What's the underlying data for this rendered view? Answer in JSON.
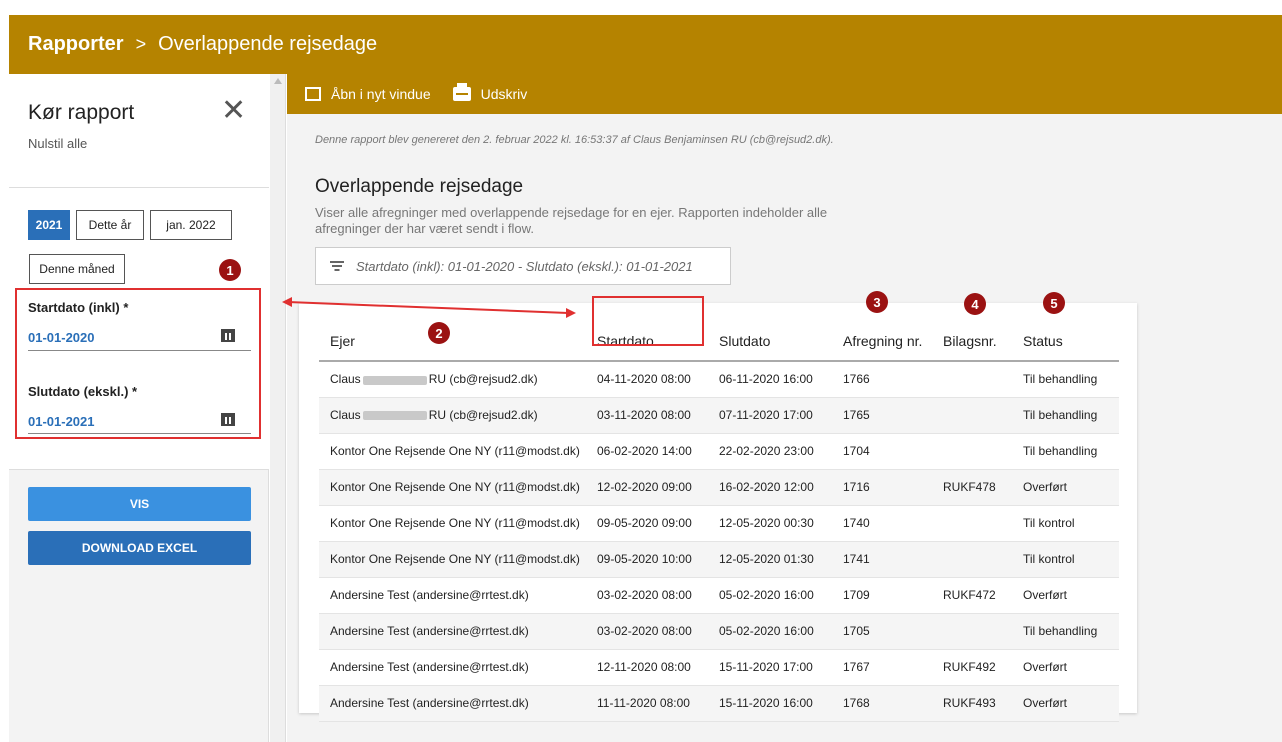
{
  "header": {
    "breadcrumb_root": "Rapporter",
    "breadcrumb_sep": ">",
    "breadcrumb_page": "Overlappende rejsedage"
  },
  "sidebar": {
    "title": "Kør rapport",
    "reset": "Nulstil alle",
    "chips": [
      "2021",
      "Dette år",
      "jan. 2022",
      "Denne måned"
    ],
    "start_label": "Startdato (inkl) *",
    "start_value": "01-01-2020",
    "end_label": "Slutdato (ekskl.) *",
    "end_value": "01-01-2021",
    "btn_vis": "VIS",
    "btn_excel": "DOWNLOAD EXCEL"
  },
  "toolbar": {
    "open_new": "Åbn i nyt vindue",
    "print": "Udskriv"
  },
  "report": {
    "generated_note": "Denne rapport blev genereret den 2. februar 2022 kl. 16:53:37 af Claus Benjaminsen RU (cb@rejsud2.dk).",
    "title": "Overlappende rejsedage",
    "description": "Viser alle afregninger med overlappende rejsedage for en ejer. Rapporten indeholder alle afregninger der har været sendt i flow.",
    "filter": "Startdato (inkl): 01-01-2020 - Slutdato (ekskl.): 01-01-2021"
  },
  "table": {
    "columns": [
      "Ejer",
      "Startdato",
      "Slutdato",
      "Afregning nr.",
      "Bilagsnr.",
      "Status"
    ],
    "rows": [
      {
        "owner_pre": "Claus",
        "owner_post": "RU (cb@rejsud2.dk)",
        "start": "04-11-2020 08:00",
        "end": "06-11-2020 16:00",
        "nr": "1766",
        "bilag": "",
        "status": "Til behandling"
      },
      {
        "owner_pre": "Claus",
        "owner_post": "RU (cb@rejsud2.dk)",
        "start": "03-11-2020 08:00",
        "end": "07-11-2020 17:00",
        "nr": "1765",
        "bilag": "",
        "status": "Til behandling"
      },
      {
        "owner_pre": "Kontor One Rejsende One NY (r11@modst.dk)",
        "owner_post": "",
        "start": "06-02-2020 14:00",
        "end": "22-02-2020 23:00",
        "nr": "1704",
        "bilag": "",
        "status": "Til behandling"
      },
      {
        "owner_pre": "Kontor One Rejsende One NY (r11@modst.dk)",
        "owner_post": "",
        "start": "12-02-2020 09:00",
        "end": "16-02-2020 12:00",
        "nr": "1716",
        "bilag": "RUKF478",
        "status": "Overført"
      },
      {
        "owner_pre": "Kontor One Rejsende One NY (r11@modst.dk)",
        "owner_post": "",
        "start": "09-05-2020 09:00",
        "end": "12-05-2020 00:30",
        "nr": "1740",
        "bilag": "",
        "status": "Til kontrol"
      },
      {
        "owner_pre": "Kontor One Rejsende One NY (r11@modst.dk)",
        "owner_post": "",
        "start": "09-05-2020 10:00",
        "end": "12-05-2020 01:30",
        "nr": "1741",
        "bilag": "",
        "status": "Til kontrol"
      },
      {
        "owner_pre": "Andersine Test (andersine@rrtest.dk)",
        "owner_post": "",
        "start": "03-02-2020 08:00",
        "end": "05-02-2020 16:00",
        "nr": "1709",
        "bilag": "RUKF472",
        "status": "Overført"
      },
      {
        "owner_pre": "Andersine Test (andersine@rrtest.dk)",
        "owner_post": "",
        "start": "03-02-2020 08:00",
        "end": "05-02-2020 16:00",
        "nr": "1705",
        "bilag": "",
        "status": "Til behandling"
      },
      {
        "owner_pre": "Andersine Test (andersine@rrtest.dk)",
        "owner_post": "",
        "start": "12-11-2020 08:00",
        "end": "15-11-2020 17:00",
        "nr": "1767",
        "bilag": "RUKF492",
        "status": "Overført"
      },
      {
        "owner_pre": "Andersine Test (andersine@rrtest.dk)",
        "owner_post": "",
        "start": "11-11-2020 08:00",
        "end": "15-11-2020 16:00",
        "nr": "1768",
        "bilag": "RUKF493",
        "status": "Overført"
      }
    ]
  },
  "annotations": {
    "badges": [
      "1",
      "2",
      "3",
      "4",
      "5"
    ]
  },
  "colors": {
    "brand": "#b58300",
    "primary": "#2a6fb8",
    "highlight": "#e03030",
    "badge": "#9b1212"
  }
}
